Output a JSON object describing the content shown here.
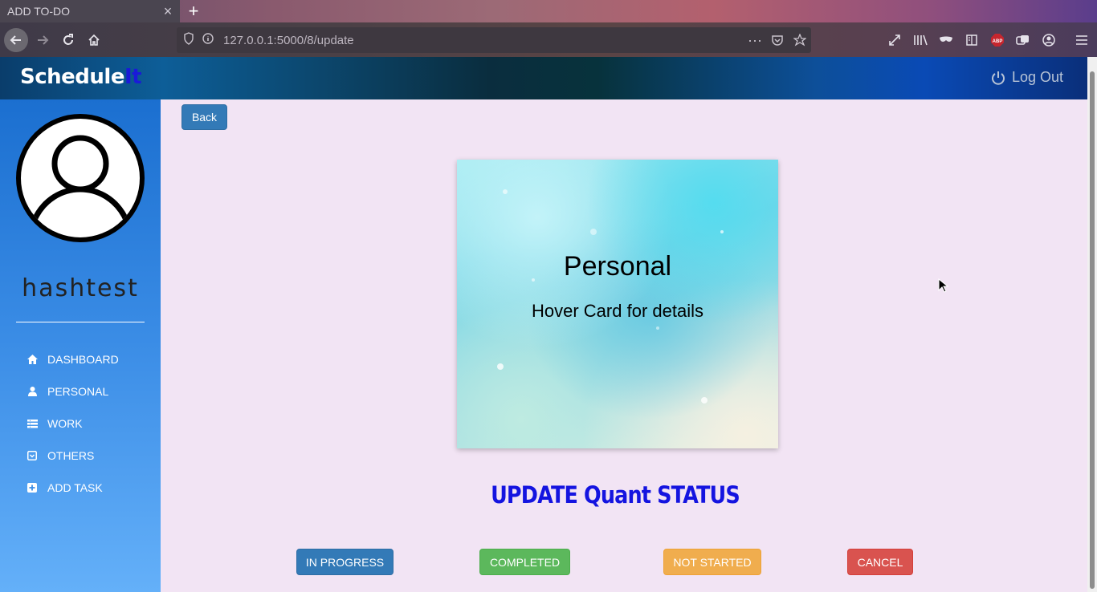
{
  "browser": {
    "tab_title": "ADD TO-DO",
    "tab_close": "×",
    "new_tab": "+",
    "url": "127.0.0.1:5000/8/update",
    "url_actions": "···"
  },
  "app": {
    "brand_main": "Schedule",
    "brand_accent": "It",
    "logout_label": "Log Out"
  },
  "sidebar": {
    "username": "hashtest",
    "items": [
      {
        "label": "DASHBOARD",
        "icon": "home-icon"
      },
      {
        "label": "PERSONAL",
        "icon": "user-icon"
      },
      {
        "label": "WORK",
        "icon": "list-icon"
      },
      {
        "label": "OTHERS",
        "icon": "inbox-icon"
      },
      {
        "label": "ADD TASK",
        "icon": "plus-square-icon"
      }
    ]
  },
  "main": {
    "back_label": "Back",
    "card_title": "Personal",
    "card_subtitle": "Hover Card for details",
    "heading": "UPDATE Quant STATUS",
    "buttons": {
      "in_progress": "IN PROGRESS",
      "completed": "COMPLETED",
      "not_started": "NOT STARTED",
      "cancel": "CANCEL"
    }
  },
  "colors": {
    "primary": "#337ab7",
    "success": "#5cb85c",
    "warning": "#f0ad4e",
    "danger": "#d9534f",
    "heading": "#1414e0",
    "page_bg": "#f2e4f4"
  }
}
